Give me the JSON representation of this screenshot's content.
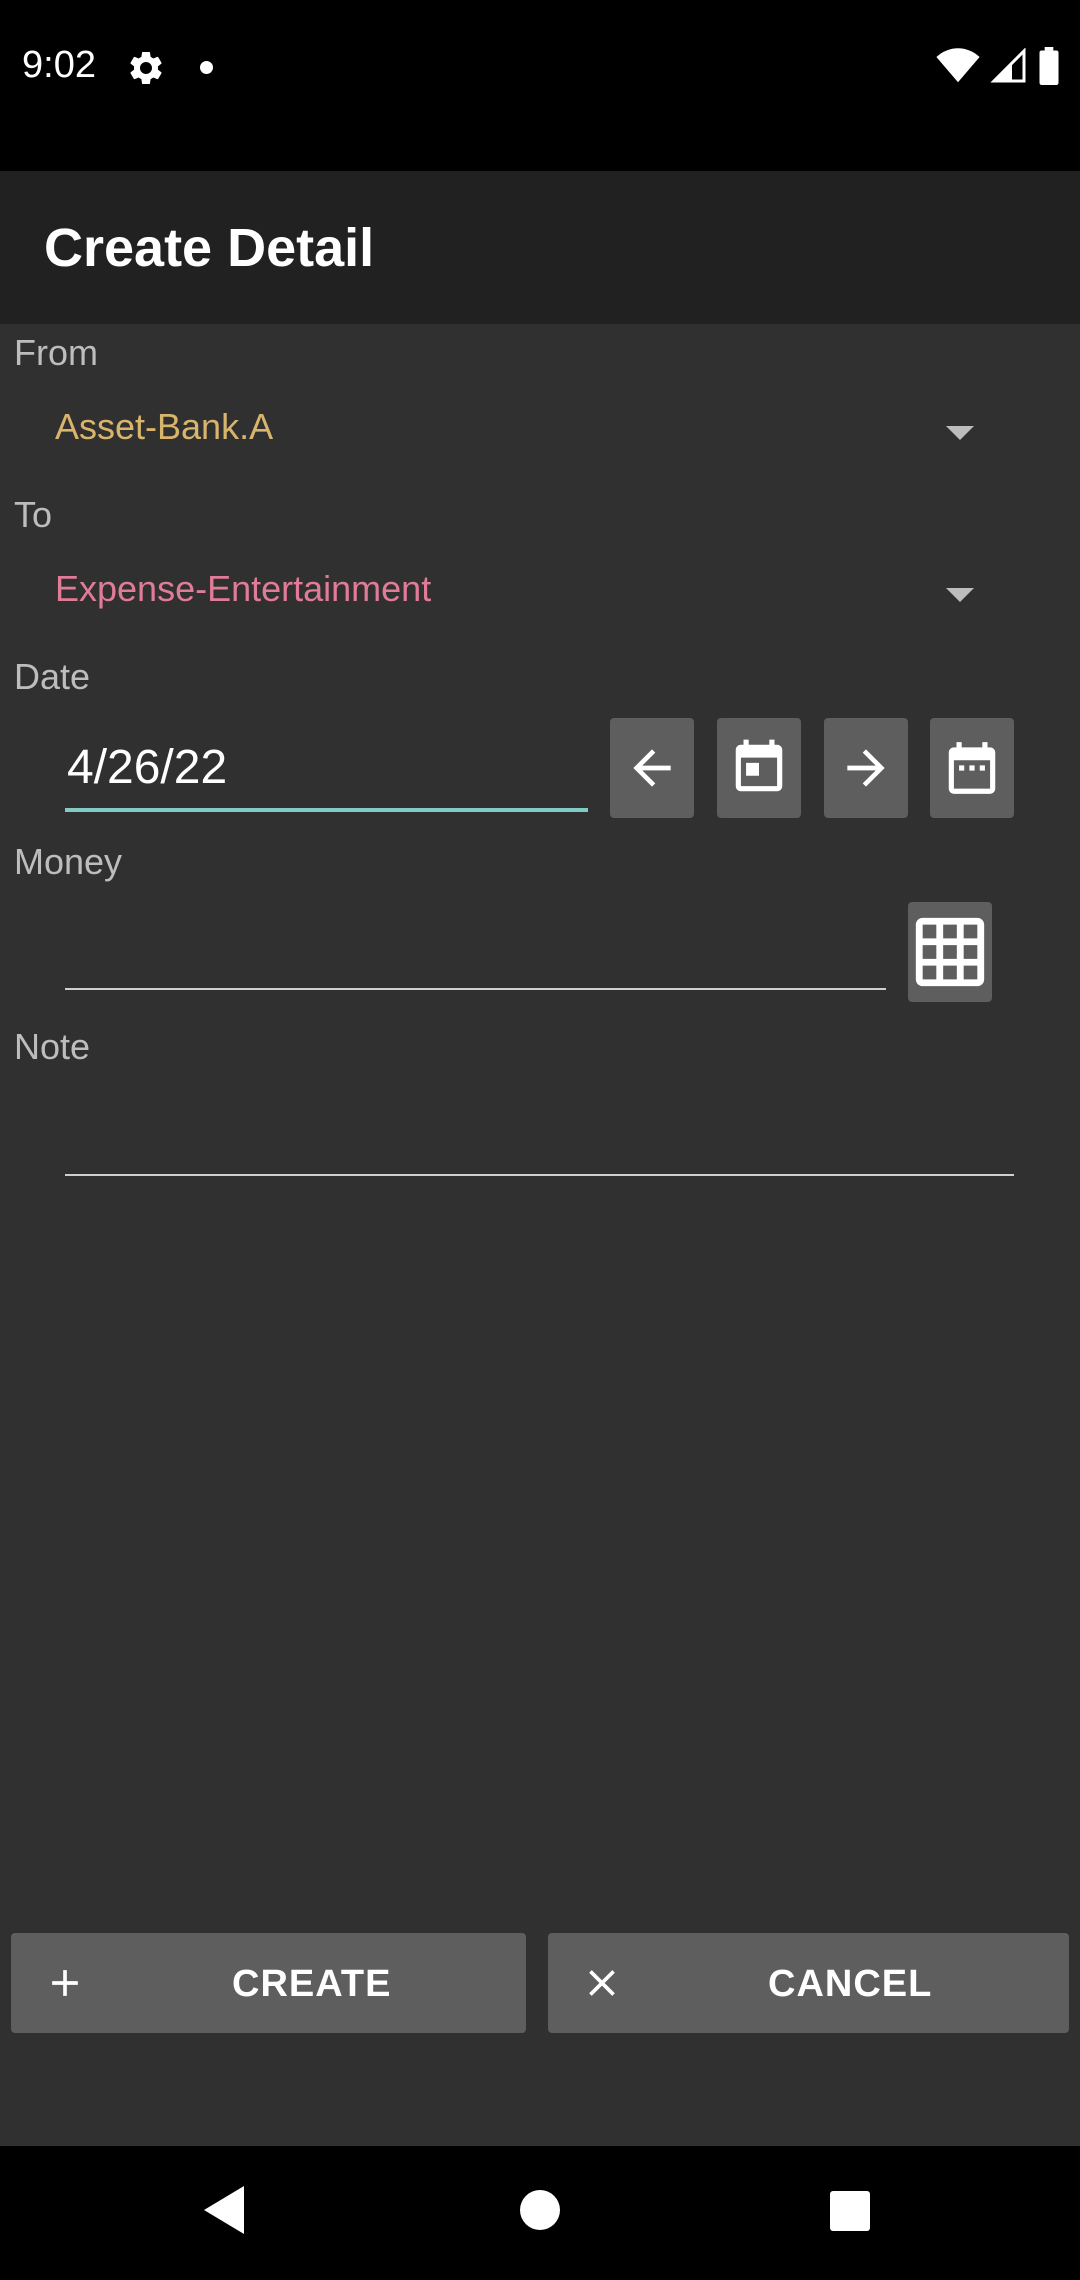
{
  "status_bar": {
    "time": "9:02",
    "icons": [
      "settings-icon",
      "notification-dot-icon",
      "wifi-icon",
      "signal-icon",
      "battery-icon"
    ]
  },
  "app_bar": {
    "title": "Create Detail"
  },
  "form": {
    "from": {
      "label": "From",
      "value": "Asset-Bank.A",
      "value_color": "#d9b56c"
    },
    "to": {
      "label": "To",
      "value": "Expense-Entertainment",
      "value_color": "#e07b98"
    },
    "date": {
      "label": "Date",
      "value": "4/26/22",
      "buttons": [
        "previous-day-icon",
        "today-icon",
        "next-day-icon",
        "calendar-picker-icon"
      ]
    },
    "money": {
      "label": "Money",
      "value": "",
      "button": "calculator-icon"
    },
    "note": {
      "label": "Note",
      "value": ""
    }
  },
  "actions": {
    "create_label": "CREATE",
    "cancel_label": "CANCEL"
  },
  "colors": {
    "accent": "#80cbc4",
    "background": "#303030",
    "app_bar": "#212121",
    "button": "#5e5e5e"
  },
  "nav_bar": {
    "icons": [
      "back-icon",
      "home-icon",
      "recents-icon"
    ]
  }
}
